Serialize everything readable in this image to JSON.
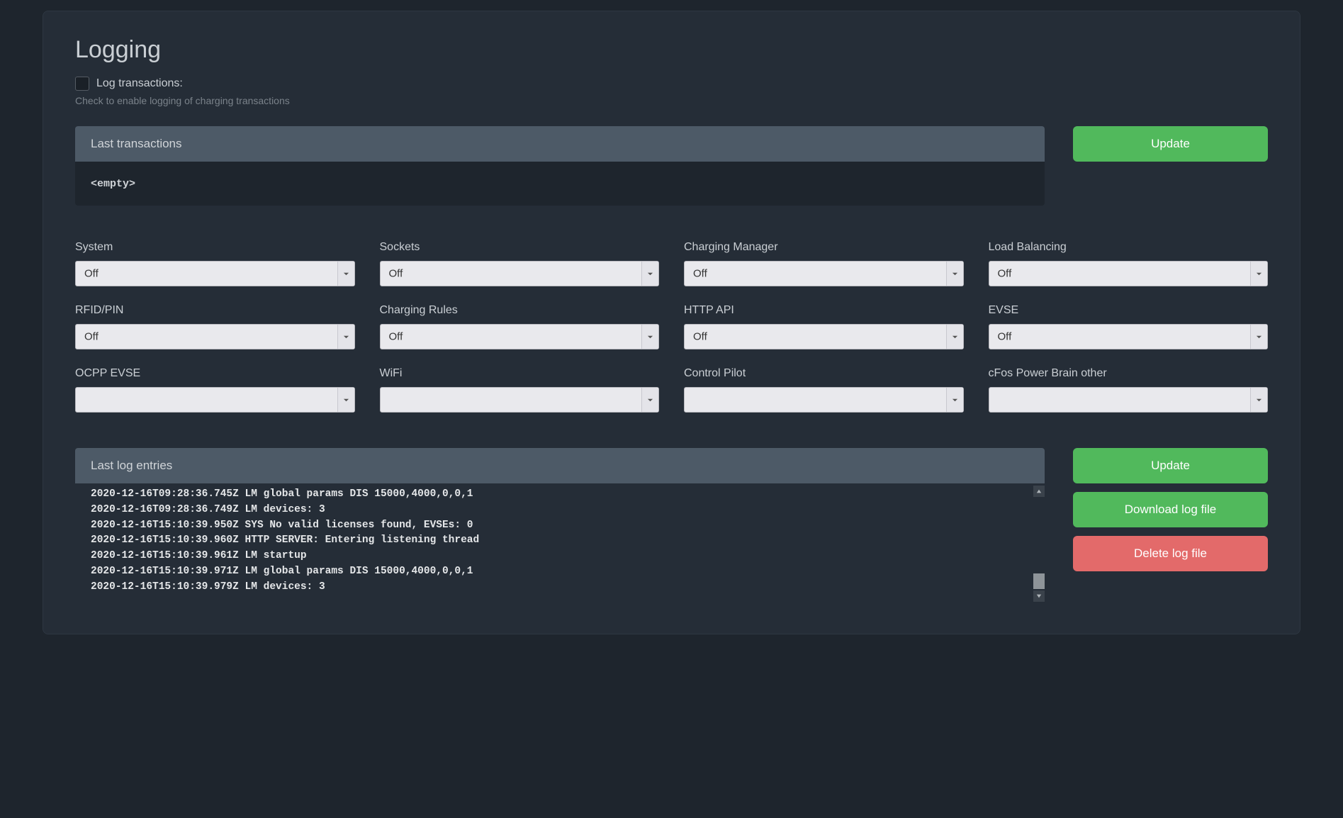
{
  "page_title": "Logging",
  "log_transactions_label": "Log transactions:",
  "log_transactions_helper": "Check to enable logging of charging transactions",
  "last_transactions_header": "Last transactions",
  "last_transactions_body": "<empty>",
  "buttons": {
    "update_top": "Update",
    "update_log": "Update",
    "download_log": "Download log file",
    "delete_log": "Delete log file"
  },
  "selects": [
    {
      "label": "System",
      "value": "Off"
    },
    {
      "label": "Sockets",
      "value": "Off"
    },
    {
      "label": "Charging Manager",
      "value": "Off"
    },
    {
      "label": "Load Balancing",
      "value": "Off"
    },
    {
      "label": "RFID/PIN",
      "value": "Off"
    },
    {
      "label": "Charging Rules",
      "value": "Off"
    },
    {
      "label": "HTTP API",
      "value": "Off"
    },
    {
      "label": "EVSE",
      "value": "Off"
    },
    {
      "label": "OCPP EVSE",
      "value": ""
    },
    {
      "label": "WiFi",
      "value": ""
    },
    {
      "label": "Control Pilot",
      "value": ""
    },
    {
      "label": "cFos Power Brain other",
      "value": ""
    }
  ],
  "last_log_header": "Last log entries",
  "log_lines": [
    "2020-12-16T09:28:36.745Z LM global params DIS 15000,4000,0,0,1",
    "2020-12-16T09:28:36.749Z LM devices: 3",
    "2020-12-16T15:10:39.950Z SYS No valid licenses found, EVSEs: 0",
    "2020-12-16T15:10:39.960Z HTTP SERVER: Entering listening thread",
    "2020-12-16T15:10:39.961Z LM startup",
    "2020-12-16T15:10:39.971Z LM global params DIS 15000,4000,0,0,1",
    "2020-12-16T15:10:39.979Z LM devices: 3"
  ]
}
